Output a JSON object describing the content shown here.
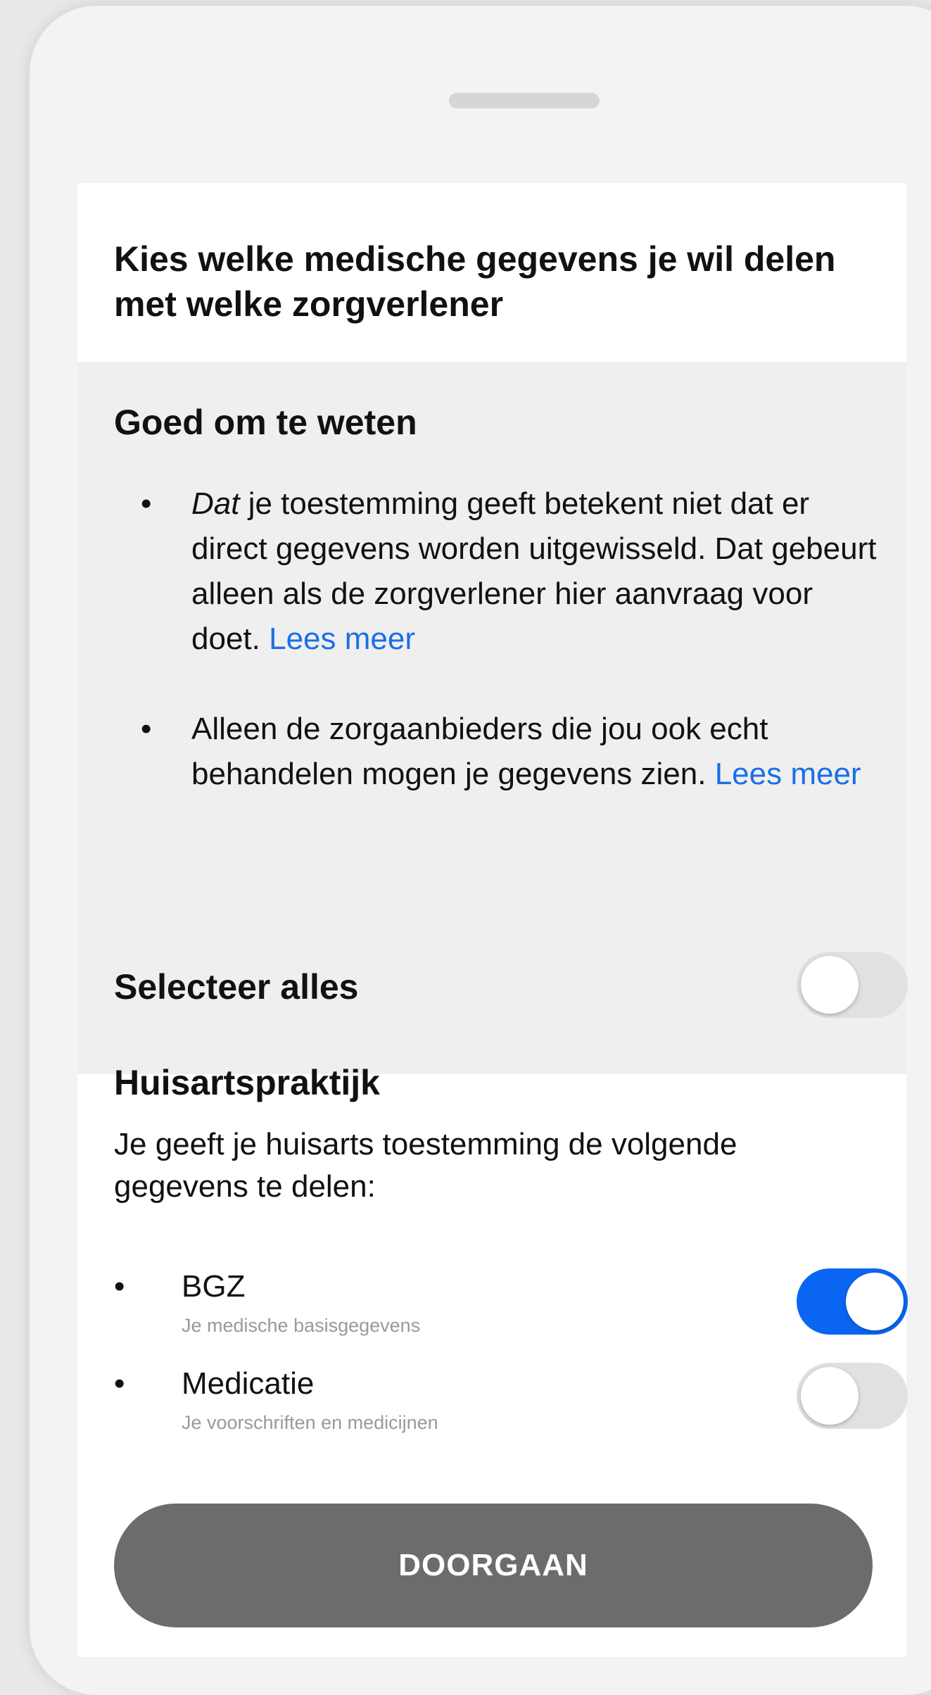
{
  "sheet": {
    "title": "Kies welke medische gegevens je wil delen met welke zorgverlener"
  },
  "info": {
    "heading": "Goed om te weten",
    "bullets": [
      {
        "emphasis": "Dat",
        "text": " je toestemming geeft betekent niet dat er direct gegevens worden uitgewisseld. Dat gebeurt alleen als de zorgverlener hier aanvraag voor doet. ",
        "link": "Lees meer"
      },
      {
        "emphasis": "",
        "text": "Alleen de zorgaanbieders die jou ook echt behandelen mogen je gegevens zien. ",
        "link": "Lees meer"
      }
    ]
  },
  "select_all": {
    "label": "Selecteer alles",
    "enabled": false
  },
  "practice": {
    "heading": "Huisartspraktijk",
    "description": "Je geeft je huisarts toestemming de volgende gegevens te delen:",
    "items": [
      {
        "name": "BGZ",
        "subtitle": "Je medische basisgegevens",
        "enabled": true
      },
      {
        "name": "Medicatie",
        "subtitle": "Je voorschriften en medicijnen",
        "enabled": false
      }
    ]
  },
  "continue_label": "DOORGAAN",
  "colors": {
    "accent": "#0a66f2",
    "link": "#1a6fe8",
    "button": "#6c6c6c",
    "toggle_off": "#e1e1e1"
  }
}
